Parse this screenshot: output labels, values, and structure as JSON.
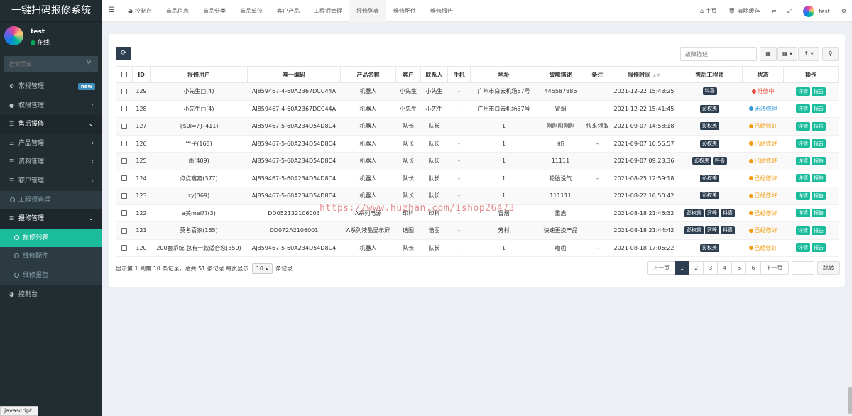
{
  "app_title": "一键扫码报修系统",
  "user": {
    "name": "test",
    "status": "在线"
  },
  "sidebar_search_placeholder": "搜索菜单",
  "menu": {
    "routine": "常规管理",
    "routine_badge": "new",
    "permission": "权限管理",
    "after_sales": "售后报修",
    "product_mgmt": "产品管理",
    "data_mgmt": "资料管理",
    "customer_mgmt": "客户管理",
    "engineer_mgmt": "工程师管理",
    "repair_mgmt": "报修管理",
    "repair_list": "报修列表",
    "repair_parts": "维修配件",
    "repair_report": "维修报告",
    "dashboard": "控制台"
  },
  "tabs": [
    "控制台",
    "商品信息",
    "商品分类",
    "商品单位",
    "客户产品",
    "工程师管理",
    "报修列表",
    "维修配件",
    "维修报告"
  ],
  "topright": {
    "home": "主页",
    "clear_cache": "清除缓存",
    "user": "test"
  },
  "search_placeholder": "故障描述",
  "columns": [
    "ID",
    "报修用户",
    "唯一编码",
    "产品名称",
    "客户",
    "联系人",
    "手机",
    "地址",
    "故障描述",
    "备注",
    "报修时间",
    "售后工程师",
    "状态",
    "操作"
  ],
  "rows": [
    {
      "id": "129",
      "user": "小先生□(4)",
      "code": "AJ859467-4-60A2367DCC44A",
      "product": "机器人",
      "customer": "小先生",
      "contact": "小先生",
      "phone": "-",
      "address": "广州市白云机场57号",
      "fault": "445587886",
      "note": "",
      "time": "2021-12-22 15:43:25",
      "engineers": [
        "料喜"
      ],
      "status": "维修中",
      "status_color": "#e74c3c"
    },
    {
      "id": "128",
      "user": "小先生□(4)",
      "code": "AJ859467-4-60A2367DCC44A",
      "product": "机器人",
      "customer": "小先生",
      "contact": "小先生",
      "phone": "-",
      "address": "广州市白云机场57号",
      "fault": "冒烟",
      "note": "",
      "time": "2021-12-22 15:41:45",
      "engineers": [
        "彭权美"
      ],
      "status": "无法修理",
      "status_color": "#3498db"
    },
    {
      "id": "127",
      "user": "{$0l=?}(411)",
      "code": "AJ859467-5-60A234D54D8C4",
      "product": "机器人",
      "customer": "队长",
      "contact": "队长",
      "phone": "-",
      "address": "1",
      "fault": "刚刚刚刚刚",
      "note": "快来领取",
      "time": "2021-09-07 14:58:18",
      "engineers": [
        "彭权美"
      ],
      "status": "已经修好",
      "status_color": "#f39c12"
    },
    {
      "id": "126",
      "user": "竹子(168)",
      "code": "AJ859467-5-60A234D54D8C4",
      "product": "机器人",
      "customer": "队长",
      "contact": "队长",
      "phone": "-",
      "address": "1",
      "fault": "囧?",
      "note": "-",
      "time": "2021-09-07 10:56:57",
      "engineers": [
        "彭权美"
      ],
      "status": "已经修好",
      "status_color": "#f39c12"
    },
    {
      "id": "125",
      "user": "雨(409)",
      "code": "AJ859467-5-60A234D54D8C4",
      "product": "机器人",
      "customer": "队长",
      "contact": "队长",
      "phone": "-",
      "address": "1",
      "fault": "11111",
      "note": "",
      "time": "2021-09-07 09:23:36",
      "engineers": [
        "彭权美",
        "料喜"
      ],
      "status": "已经修好",
      "status_color": "#f39c12"
    },
    {
      "id": "124",
      "user": "点点窩窩(377)",
      "code": "AJ859467-5-60A234D54D8C4",
      "product": "机器人",
      "customer": "队长",
      "contact": "队长",
      "phone": "-",
      "address": "1",
      "fault": "轮胎没气",
      "note": "-",
      "time": "2021-08-25 12:59:18",
      "engineers": [
        "彭权美"
      ],
      "status": "已经修好",
      "status_color": "#f39c12"
    },
    {
      "id": "123",
      "user": "zy(369)",
      "code": "AJ859467-5-60A234D54D8C4",
      "product": "机器人",
      "customer": "队长",
      "contact": "队长",
      "phone": "-",
      "address": "1",
      "fault": "111111",
      "note": "",
      "time": "2021-08-22 16:50:42",
      "engineers": [
        "彭权美"
      ],
      "status": "已经修好",
      "status_color": "#f39c12"
    },
    {
      "id": "122",
      "user": "a美mei??(3)",
      "code": "DD052132106003",
      "product": "A系列电源",
      "customer": "印科",
      "contact": "印科",
      "phone": "-",
      "address": "冒烟",
      "fault": "重启",
      "note": "",
      "time": "2021-08-18 21:46:32",
      "engineers": [
        "彭权美",
        "罗峰",
        "料喜"
      ],
      "status": "已经修好",
      "status_color": "#f39c12"
    },
    {
      "id": "121",
      "user": "莫名喜家(165)",
      "code": "DD072A2106001",
      "product": "A系列液晶显示屏",
      "customer": "谐图",
      "contact": "谐图",
      "phone": "-",
      "address": "芳村",
      "fault": "快速更换产品",
      "note": "",
      "time": "2021-08-18 21:44:42",
      "engineers": [
        "彭权美",
        "罗峰",
        "料喜"
      ],
      "status": "已经修好",
      "status_color": "#f39c12"
    },
    {
      "id": "120",
      "user": "200套系统 总有一款适合您(359)",
      "code": "AJ859467-5-60A234D54D8C4",
      "product": "机器人",
      "customer": "队长",
      "contact": "队长",
      "phone": "-",
      "address": "1",
      "fault": "啪啪",
      "note": "-",
      "time": "2021-08-18 17:06:22",
      "engineers": [
        "彭权美"
      ],
      "status": "已经修好",
      "status_color": "#f39c12"
    }
  ],
  "actions": {
    "detail": "详情",
    "report": "报告"
  },
  "footer": {
    "info_prefix": "显示第 1 到第 10 条记录，总共 51 条记录 每页显示",
    "page_size": "10",
    "info_suffix": "条记录"
  },
  "pagination": {
    "prev": "上一页",
    "pages": [
      "1",
      "2",
      "3",
      "4",
      "5",
      "6"
    ],
    "next": "下一页",
    "go": "跳转"
  },
  "watermark": "https://www.huzhan.com/ishop26473",
  "status_bar": "javascript:"
}
